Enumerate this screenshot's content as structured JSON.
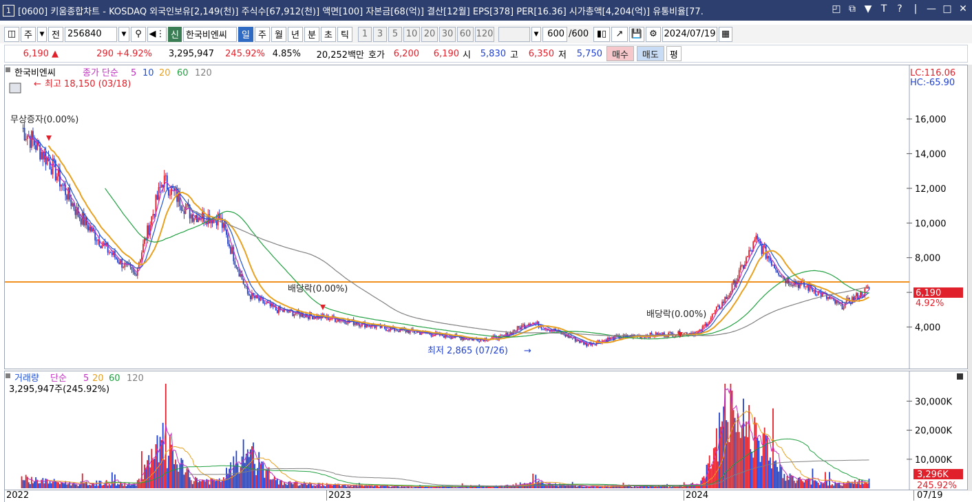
{
  "window": {
    "number": "1",
    "title": "[0600] 키움종합차트 - KOSDAQ 외국인보유[2,149(천)] 주식수[67,912(천)] 액면[100] 자본금[68(억)] 결산[12월] EPS[378] PER[16.36] 시가총액[4,204(억)] 유통비율[77.",
    "controls": [
      "restore-layout",
      "copy",
      "pin",
      "text",
      "help",
      "minimize",
      "maximize",
      "close"
    ]
  },
  "toolbar": {
    "market": "주",
    "all": "전",
    "code": "256840",
    "sin": "신",
    "stock_name": "한국비엔씨",
    "periods": [
      "일",
      "주",
      "월",
      "년",
      "분",
      "초",
      "틱"
    ],
    "active_period": "일",
    "intervals": [
      "1",
      "3",
      "5",
      "10",
      "20",
      "30",
      "60",
      "120"
    ],
    "count": "600",
    "count_total": "/600",
    "date": "2024/07/19"
  },
  "quote": {
    "price": "6,190",
    "change": "290",
    "change_pct": "+4.92%",
    "volume": "3,295,947",
    "volume_ratio": "245.92%",
    "turnover": "4.85%",
    "amount": "20,252백만",
    "hoga_label": "호가",
    "ask": "6,200",
    "bid": "6,190",
    "open_label": "시",
    "open": "5,830",
    "high_label": "고",
    "high": "6,350",
    "low_label": "저",
    "low": "5,750",
    "buy": "매수",
    "sell": "매도",
    "eval": "평"
  },
  "price_panel": {
    "legend": {
      "name": "한국비엔씨",
      "series": "종가 단순",
      "ma": [
        "5",
        "10",
        "20",
        "60",
        "120"
      ]
    },
    "lc": "LC:116.06",
    "hc": "HC:-65.90",
    "annotations": {
      "high": "최고 18,150 (03/18)",
      "low": "최저 2,865 (07/26)",
      "capital": "무상증자(0.00%)",
      "dividend1": "배당락(0.00%)",
      "dividend2": "배당락(0.00%)"
    },
    "last_price": "6,190",
    "last_pct": "4.92%"
  },
  "volume_panel": {
    "legend": {
      "name": "거래량",
      "series": "단순",
      "ma": [
        "5",
        "20",
        "60",
        "120"
      ]
    },
    "info": "3,295,947주(245.92%)",
    "last_volume": "3,296K",
    "last_pct": "245.92%"
  },
  "x_axis": [
    "2022",
    "2023",
    "2024",
    "07/19"
  ],
  "chart_data": [
    {
      "type": "candlestick",
      "series_name": "종가",
      "x": [
        "2022-01",
        "2022-02",
        "2022-03",
        "2022-04",
        "2022-05",
        "2022-06",
        "2022-07",
        "2022-08",
        "2022-09",
        "2022-10",
        "2022-11",
        "2022-12",
        "2023-01",
        "2023-02",
        "2023-03",
        "2023-04",
        "2023-05",
        "2023-06",
        "2023-07",
        "2023-08",
        "2023-09",
        "2023-10",
        "2023-11",
        "2023-12",
        "2024-01",
        "2024-02",
        "2024-03",
        "2024-04",
        "2024-05",
        "2024-06",
        "2024-07"
      ],
      "close": [
        15500,
        13500,
        10500,
        8500,
        7000,
        12500,
        10500,
        10300,
        5900,
        5000,
        4700,
        4500,
        4200,
        3900,
        3700,
        3500,
        3300,
        3400,
        4300,
        3700,
        3000,
        3400,
        3500,
        3600,
        3700,
        5800,
        9000,
        6800,
        6200,
        5200,
        6190
      ],
      "y_ticks": [
        "4,000",
        "6,000",
        "8,000",
        "10,000",
        "12,000",
        "14,000",
        "16,000"
      ],
      "ylim": [
        2000,
        18300
      ],
      "horizontal_line": 6600,
      "moving_averages": [
        "5",
        "10",
        "20",
        "60",
        "120"
      ]
    },
    {
      "type": "bar",
      "series_name": "거래량",
      "x": [
        "2022-01",
        "2022-02",
        "2022-03",
        "2022-04",
        "2022-05",
        "2022-06",
        "2022-07",
        "2022-08",
        "2022-09",
        "2022-10",
        "2022-11",
        "2022-12",
        "2023-01",
        "2023-02",
        "2023-03",
        "2023-04",
        "2023-05",
        "2023-06",
        "2023-07",
        "2023-08",
        "2023-09",
        "2023-10",
        "2023-11",
        "2023-12",
        "2024-01",
        "2024-02",
        "2024-03",
        "2024-04",
        "2024-05",
        "2024-06",
        "2024-07"
      ],
      "values": [
        4500,
        3000,
        2000,
        2500,
        1500,
        20000,
        4000,
        3000,
        17000,
        3000,
        2000,
        1500,
        1200,
        1000,
        800,
        800,
        700,
        900,
        3000,
        1500,
        800,
        900,
        1000,
        800,
        2000,
        34000,
        28000,
        5000,
        3000,
        2000,
        3296
      ],
      "y_ticks": [
        "10,000K",
        "20,000K",
        "30,000K"
      ],
      "ylim": [
        0,
        36000
      ],
      "unit": "K"
    }
  ]
}
